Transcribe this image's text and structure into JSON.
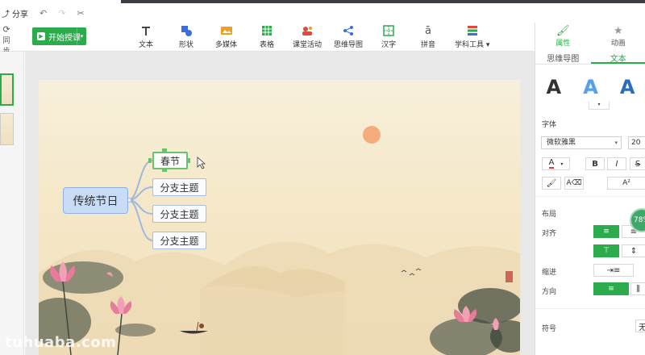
{
  "title_bar": {
    "share_label": "分享",
    "undo_icon": "undo-icon",
    "redo_icon": "redo-icon",
    "clear_icon": "scissors-icon"
  },
  "toolbar": {
    "sync_label": "同步",
    "start_label": "开始授课",
    "tools": [
      {
        "label": "文本",
        "icon": "text-icon"
      },
      {
        "label": "形状",
        "icon": "shape-icon"
      },
      {
        "label": "多媒体",
        "icon": "media-icon"
      },
      {
        "label": "表格",
        "icon": "table-icon"
      },
      {
        "label": "课堂活动",
        "icon": "activity-icon"
      },
      {
        "label": "思维导图",
        "icon": "mindmap-icon"
      },
      {
        "label": "汉字",
        "icon": "hanzi-icon"
      },
      {
        "label": "拼音",
        "icon": "pinyin-icon"
      },
      {
        "label": "学科工具",
        "icon": "subject-tools-icon"
      }
    ]
  },
  "mindmap": {
    "central": "传统节日",
    "branches": [
      "春节",
      "分支主题",
      "分支主题",
      "分支主题"
    ]
  },
  "right_panel": {
    "tabs": [
      "属性",
      "动画"
    ],
    "subtabs": [
      "思维导图",
      "文本"
    ],
    "style_sample": "A",
    "font_section": "字体",
    "font_name": "微软雅黑",
    "font_size": "20",
    "bold": "B",
    "italic": "I",
    "strike": "S",
    "superscript": "A²",
    "layout_section": "布局",
    "align_label": "对齐",
    "indent_label": "缩进",
    "direction_label": "方向",
    "symbol_label": "符号",
    "symbol_value": "无"
  },
  "progress_badge": "78%",
  "watermark": "tuhuaba.com",
  "colors": {
    "accent": "#2bab4b",
    "central_node": "#c9dcf6"
  }
}
